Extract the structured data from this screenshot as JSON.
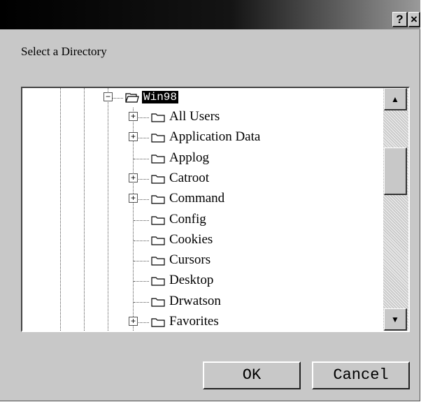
{
  "titlebar": {
    "help_label": "?",
    "close_label": "×"
  },
  "dialog": {
    "prompt": "Select a Directory"
  },
  "tree": {
    "selected": {
      "label": "Win98",
      "expander": "−"
    },
    "items": [
      {
        "label": "All Users",
        "expander": "+"
      },
      {
        "label": "Application Data",
        "expander": "+"
      },
      {
        "label": "Applog",
        "expander": ""
      },
      {
        "label": "Catroot",
        "expander": "+"
      },
      {
        "label": "Command",
        "expander": "+"
      },
      {
        "label": "Config",
        "expander": ""
      },
      {
        "label": "Cookies",
        "expander": ""
      },
      {
        "label": "Cursors",
        "expander": ""
      },
      {
        "label": "Desktop",
        "expander": ""
      },
      {
        "label": "Drwatson",
        "expander": ""
      },
      {
        "label": "Favorites",
        "expander": "+"
      }
    ]
  },
  "scrollbar": {
    "up_glyph": "▲",
    "down_glyph": "▼"
  },
  "buttons": {
    "ok": "OK",
    "cancel": "Cancel"
  }
}
